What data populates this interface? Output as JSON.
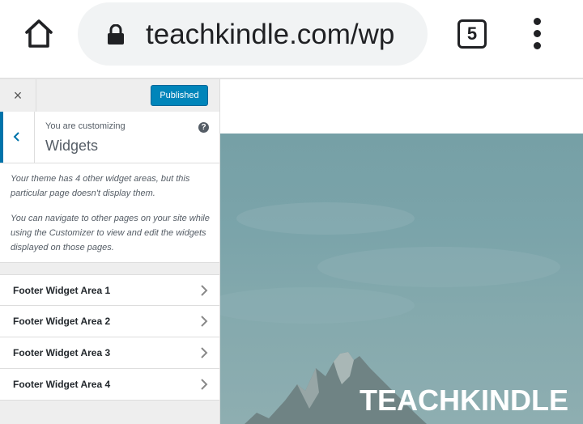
{
  "browser": {
    "url": "teachkindle.com/wp",
    "tab_count": "5",
    "icons": [
      "home-icon",
      "lock-icon",
      "tabs-icon",
      "more-vert-icon"
    ]
  },
  "customizer": {
    "close_label": "×",
    "publish_button": "Published",
    "customizing_label": "You are customizing",
    "section_title": "Widgets",
    "help_label": "?",
    "description_1": "Your theme has 4 other widget areas, but this particular page doesn't display them.",
    "description_2": "You can navigate to other pages on your site while using the Customizer to view and edit the widgets displayed on those pages.",
    "widget_areas": [
      {
        "label": "Footer Widget Area 1"
      },
      {
        "label": "Footer Widget Area 2"
      },
      {
        "label": "Footer Widget Area 3"
      },
      {
        "label": "Footer Widget Area 4"
      }
    ],
    "accent_color": "#0085ba"
  },
  "preview": {
    "brand_text": "TEACHKINDLE"
  }
}
